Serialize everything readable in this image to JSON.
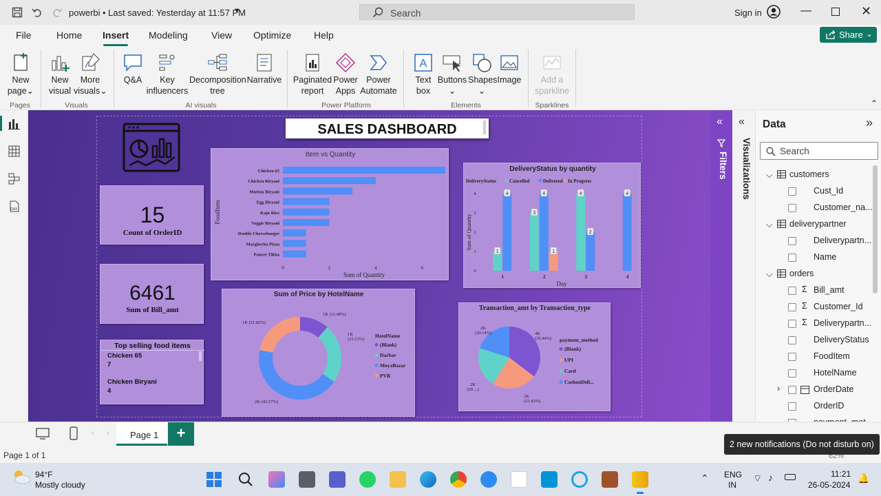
{
  "titlebar": {
    "doc_title": "powerbi",
    "saved": "Last saved: Yesterday at 11:57 PM",
    "search_placeholder": "Search",
    "signin": "Sign in"
  },
  "menu": {
    "items": [
      "File",
      "Home",
      "Insert",
      "Modeling",
      "View",
      "Optimize",
      "Help"
    ],
    "active": "Insert",
    "share": "Share"
  },
  "ribbon": {
    "buttons": [
      {
        "label1": "New",
        "label2": "page",
        "dropdown": true,
        "icon": "new-page-icon"
      },
      {
        "label1": "New",
        "label2": "visual",
        "icon": "new-visual-icon"
      },
      {
        "label1": "More",
        "label2": "visuals",
        "dropdown": true,
        "icon": "more-visuals-icon"
      },
      {
        "label1": "Q&A",
        "label2": "",
        "icon": "qa-icon"
      },
      {
        "label1": "Key",
        "label2": "influencers",
        "icon": "key-influencers-icon"
      },
      {
        "label1": "Decomposition",
        "label2": "tree",
        "icon": "decomposition-tree-icon"
      },
      {
        "label1": "Narrative",
        "label2": "",
        "icon": "narrative-icon"
      },
      {
        "label1": "Paginated",
        "label2": "report",
        "icon": "paginated-report-icon"
      },
      {
        "label1": "Power",
        "label2": "Apps",
        "icon": "power-apps-icon"
      },
      {
        "label1": "Power",
        "label2": "Automate",
        "icon": "power-automate-icon"
      },
      {
        "label1": "Text",
        "label2": "box",
        "icon": "text-box-icon"
      },
      {
        "label1": "Buttons",
        "label2": "",
        "dropdown": true,
        "icon": "buttons-icon"
      },
      {
        "label1": "Shapes",
        "label2": "",
        "dropdown": true,
        "icon": "shapes-icon"
      },
      {
        "label1": "Image",
        "label2": "",
        "icon": "image-icon"
      },
      {
        "label1": "Add a",
        "label2": "sparkline",
        "disabled": true,
        "icon": "sparkline-icon"
      }
    ],
    "groups": [
      "Pages",
      "Visuals",
      "AI visuals",
      "Power Platform",
      "Elements",
      "Sparklines"
    ]
  },
  "dashboard": {
    "title": "SALES DASHBOARD",
    "kpi1": {
      "value": "15",
      "label": "Count of OrderID"
    },
    "kpi2": {
      "value": "6461",
      "label": "Sum of Bill_amt"
    },
    "top_selling": {
      "title": "Top selling food items",
      "items": [
        {
          "name": "Chicken 65",
          "value": "7"
        },
        {
          "name": "Chicken Biryani",
          "value": "4"
        }
      ]
    },
    "colors": {
      "purple": "#7e55d0",
      "teal": "#5fd3c9",
      "blue": "#4f8ff7",
      "orange": "#f59a7c",
      "card": "#b18fdb"
    }
  },
  "chart_data": [
    {
      "type": "bar",
      "orientation": "horizontal",
      "title": "Item vs Quantity",
      "xlabel": "Sum of Quantity",
      "ylabel": "FoodItem",
      "categories": [
        "Chicken 65",
        "Chicken Biryani",
        "Mutton Biryani",
        "Egg Biryani",
        "Kaju Rice",
        "Veggie Biryani",
        "Double Cheeseburger",
        "Margherita Pizza",
        "Paneer Tikka"
      ],
      "values": [
        7,
        4,
        3,
        2,
        2,
        2,
        1,
        1,
        1
      ],
      "xticks": [
        "0",
        "2",
        "4",
        "6"
      ],
      "xlim": [
        0,
        7
      ]
    },
    {
      "type": "bar",
      "title": "DeliveryStatus by quantity",
      "legend_title": "DeliveryStatus",
      "xlabel": "Day",
      "ylabel": "Sum of Quantity",
      "categories": [
        "1",
        "2",
        "3",
        "4"
      ],
      "yticks": [
        "0",
        "1",
        "2",
        "3",
        "4"
      ],
      "ylim": [
        0,
        4
      ],
      "series": [
        {
          "name": "Cancelled",
          "color": "#5fd3c9",
          "values": [
            1,
            3,
            4,
            null
          ]
        },
        {
          "name": "Delivered",
          "color": "#4f8ff7",
          "values": [
            4,
            4,
            2,
            4
          ]
        },
        {
          "name": "In Progress",
          "color": "#f59a7c",
          "values": [
            null,
            1,
            null,
            null
          ]
        }
      ],
      "data_labels": [
        [
          "1",
          "3",
          "4",
          ""
        ],
        [
          "4",
          "4",
          "2",
          "4"
        ],
        [
          "",
          "1",
          "",
          ""
        ]
      ]
    },
    {
      "type": "pie",
      "donut": true,
      "title": "Sum of Price by HotelName",
      "legend_title": "HotelName",
      "labels": [
        "(Blank)",
        "Darbar",
        "MoyaBazar",
        "PVR"
      ],
      "values": [
        11.48,
        23.13,
        43.57,
        21.82
      ],
      "colors": [
        "#7e55d0",
        "#5fd3c9",
        "#4f8ff7",
        "#f59a7c"
      ],
      "data_labels": [
        "1K (11.48%)",
        "1K (23.13%)",
        "2K (43.57%)",
        "1K (21.82%)"
      ]
    },
    {
      "type": "pie",
      "title": "Transaction_amt by Transaction_type",
      "legend_title": "payment_method",
      "labels": [
        "(Blank)",
        "UPI",
        "Card",
        "CashonDeli..."
      ],
      "values": [
        35.44,
        23.43,
        20.99,
        20.14
      ],
      "colors": [
        "#7e55d0",
        "#f59a7c",
        "#5fd3c9",
        "#4f8ff7"
      ],
      "data_labels": [
        "4K (35.44%)",
        "2K (23.43%)",
        "2K (20....)",
        "2K (20.14%)"
      ]
    }
  ],
  "panes": {
    "filters": "Filters",
    "visualizations": "Visualizations",
    "data_title": "Data",
    "search_placeholder": "Search",
    "tables": [
      {
        "name": "customers",
        "fields": [
          "Cust_Id",
          "Customer_na..."
        ]
      },
      {
        "name": "deliverypartner",
        "fields": [
          "Deliverypartn...",
          "Name"
        ]
      },
      {
        "name": "orders",
        "fields": [
          "Bill_amt",
          "Customer_Id",
          "Deliverypartn...",
          "DeliveryStatus",
          "FoodItem",
          "HotelName",
          "OrderDate",
          "OrderID",
          "payment_met..."
        ]
      }
    ]
  },
  "pages": {
    "tab": "Page 1",
    "status": "Page 1 of 1",
    "zoom": "62%"
  },
  "notification": "2 new notifications (Do not disturb on)",
  "taskbar": {
    "weather_temp": "94°F",
    "weather_desc": "Mostly cloudy",
    "lang1": "ENG",
    "lang2": "IN",
    "time": "11:21",
    "date": "26-05-2024"
  }
}
